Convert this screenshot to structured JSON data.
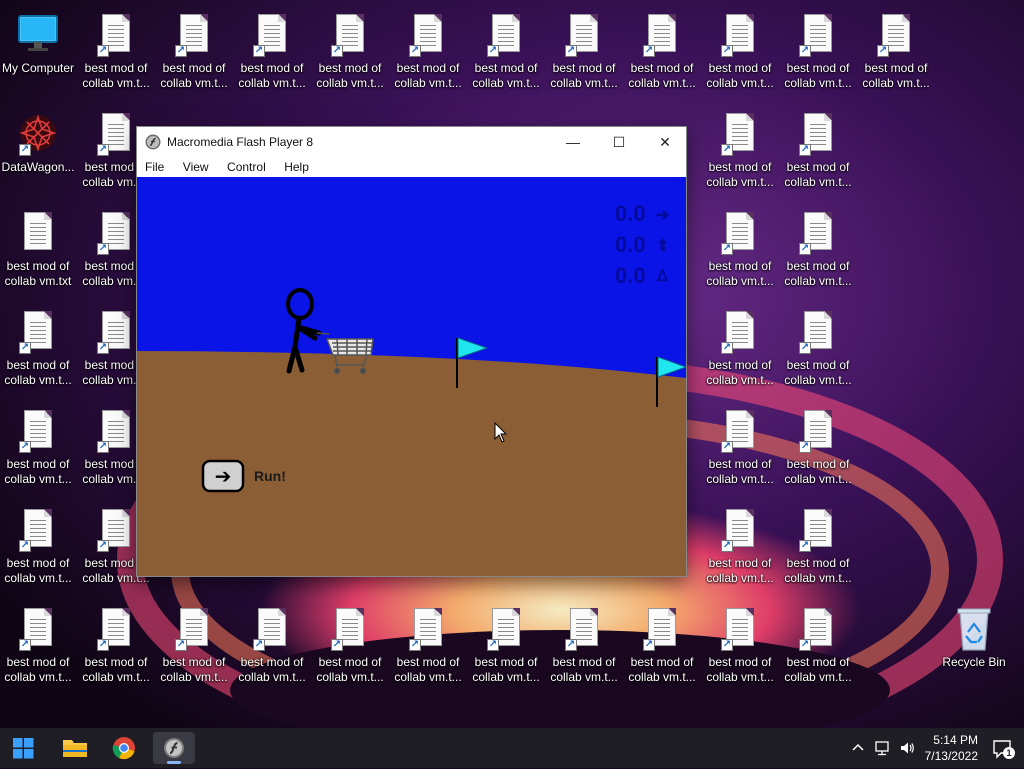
{
  "desktop": {
    "icons": [
      {
        "col": 0,
        "row": 0,
        "type": "computer",
        "label": "My Computer"
      },
      {
        "col": 1,
        "row": 0,
        "type": "doc",
        "label": "best mod of\ncollab vm.t...",
        "shortcut": true
      },
      {
        "col": 2,
        "row": 0,
        "type": "doc",
        "label": "best mod of\ncollab vm.t...",
        "shortcut": true
      },
      {
        "col": 3,
        "row": 0,
        "type": "doc",
        "label": "best mod of\ncollab vm.t...",
        "shortcut": true
      },
      {
        "col": 4,
        "row": 0,
        "type": "doc",
        "label": "best mod of\ncollab vm.t...",
        "shortcut": true
      },
      {
        "col": 5,
        "row": 0,
        "type": "doc",
        "label": "best mod of\ncollab vm.t...",
        "shortcut": true
      },
      {
        "col": 6,
        "row": 0,
        "type": "doc",
        "label": "best mod of\ncollab vm.t...",
        "shortcut": true
      },
      {
        "col": 7,
        "row": 0,
        "type": "doc",
        "label": "best mod of\ncollab vm.t...",
        "shortcut": true
      },
      {
        "col": 8,
        "row": 0,
        "type": "doc",
        "label": "best mod of\ncollab vm.t...",
        "shortcut": true
      },
      {
        "col": 9,
        "row": 0,
        "type": "doc",
        "label": "best mod of\ncollab vm.t...",
        "shortcut": true
      },
      {
        "col": 10,
        "row": 0,
        "type": "doc",
        "label": "best mod of\ncollab vm.t...",
        "shortcut": true
      },
      {
        "col": 11,
        "row": 0,
        "type": "doc",
        "label": "best mod of\ncollab vm.t...",
        "shortcut": true
      },
      {
        "col": 0,
        "row": 1,
        "type": "datawagon",
        "label": "DataWagon...",
        "shortcut": true
      },
      {
        "col": 1,
        "row": 1,
        "type": "doc",
        "label": "best mod of\ncollab vm.t...",
        "shortcut": true
      },
      {
        "col": 9,
        "row": 1,
        "type": "doc",
        "label": "best mod of\ncollab vm.t...",
        "shortcut": true
      },
      {
        "col": 10,
        "row": 1,
        "type": "doc",
        "label": "best mod of\ncollab vm.t...",
        "shortcut": true
      },
      {
        "col": 0,
        "row": 2,
        "type": "doc",
        "label": "best mod of\ncollab vm.txt",
        "shortcut": false
      },
      {
        "col": 1,
        "row": 2,
        "type": "doc",
        "label": "best mod of\ncollab vm.t...",
        "shortcut": true
      },
      {
        "col": 9,
        "row": 2,
        "type": "doc",
        "label": "best mod of\ncollab vm.t...",
        "shortcut": true
      },
      {
        "col": 10,
        "row": 2,
        "type": "doc",
        "label": "best mod of\ncollab vm.t...",
        "shortcut": true
      },
      {
        "col": 0,
        "row": 3,
        "type": "doc",
        "label": "best mod of\ncollab vm.t...",
        "shortcut": true
      },
      {
        "col": 1,
        "row": 3,
        "type": "doc",
        "label": "best mod of\ncollab vm.t...",
        "shortcut": true
      },
      {
        "col": 9,
        "row": 3,
        "type": "doc",
        "label": "best mod of\ncollab vm.t...",
        "shortcut": true
      },
      {
        "col": 10,
        "row": 3,
        "type": "doc",
        "label": "best mod of\ncollab vm.t...",
        "shortcut": true
      },
      {
        "col": 0,
        "row": 4,
        "type": "doc",
        "label": "best mod of\ncollab vm.t...",
        "shortcut": true
      },
      {
        "col": 1,
        "row": 4,
        "type": "doc",
        "label": "best mod of\ncollab vm.t...",
        "shortcut": true
      },
      {
        "col": 9,
        "row": 4,
        "type": "doc",
        "label": "best mod of\ncollab vm.t...",
        "shortcut": true
      },
      {
        "col": 10,
        "row": 4,
        "type": "doc",
        "label": "best mod of\ncollab vm.t...",
        "shortcut": true
      },
      {
        "col": 0,
        "row": 5,
        "type": "doc",
        "label": "best mod of\ncollab vm.t...",
        "shortcut": true
      },
      {
        "col": 1,
        "row": 5,
        "type": "doc",
        "label": "best mod of\ncollab vm.t...",
        "shortcut": true
      },
      {
        "col": 9,
        "row": 5,
        "type": "doc",
        "label": "best mod of\ncollab vm.t...",
        "shortcut": true
      },
      {
        "col": 10,
        "row": 5,
        "type": "doc",
        "label": "best mod of\ncollab vm.t...",
        "shortcut": true
      },
      {
        "col": 0,
        "row": 6,
        "type": "doc",
        "label": "best mod of\ncollab vm.t...",
        "shortcut": true
      },
      {
        "col": 1,
        "row": 6,
        "type": "doc",
        "label": "best mod of\ncollab vm.t...",
        "shortcut": true
      },
      {
        "col": 2,
        "row": 6,
        "type": "doc",
        "label": "best mod of\ncollab vm.t...",
        "shortcut": true
      },
      {
        "col": 3,
        "row": 6,
        "type": "doc",
        "label": "best mod of\ncollab vm.t...",
        "shortcut": true
      },
      {
        "col": 4,
        "row": 6,
        "type": "doc",
        "label": "best mod of\ncollab vm.t...",
        "shortcut": true
      },
      {
        "col": 5,
        "row": 6,
        "type": "doc",
        "label": "best mod of\ncollab vm.t...",
        "shortcut": true
      },
      {
        "col": 6,
        "row": 6,
        "type": "doc",
        "label": "best mod of\ncollab vm.t...",
        "shortcut": true
      },
      {
        "col": 7,
        "row": 6,
        "type": "doc",
        "label": "best mod of\ncollab vm.t...",
        "shortcut": true
      },
      {
        "col": 8,
        "row": 6,
        "type": "doc",
        "label": "best mod of\ncollab vm.t...",
        "shortcut": true
      },
      {
        "col": 9,
        "row": 6,
        "type": "doc",
        "label": "best mod of\ncollab vm.t...",
        "shortcut": true
      },
      {
        "col": 10,
        "row": 6,
        "type": "doc",
        "label": "best mod of\ncollab vm.t...",
        "shortcut": true
      },
      {
        "col": 12,
        "row": 6,
        "type": "recycle",
        "label": "Recycle Bin",
        "shortcut": false
      }
    ]
  },
  "window": {
    "title": "Macromedia Flash Player 8",
    "menu": [
      "File",
      "View",
      "Control",
      "Help"
    ],
    "buttons": {
      "minimize": "—",
      "maximize": "☐",
      "close": "✕"
    }
  },
  "game": {
    "stats": [
      {
        "value": "0.0",
        "symbol": "➔"
      },
      {
        "value": "0.0",
        "symbol": "⬆"
      },
      {
        "value": "0.0",
        "symbol": "ᐃ"
      }
    ],
    "run_label": "Run!",
    "run_arrow": "➔",
    "colors": {
      "sky": "#0a14e6",
      "ground": "#8c5e36",
      "flag": "#20e6ee"
    }
  },
  "taskbar": {
    "time": "5:14 PM",
    "date": "7/13/2022",
    "notification_count": "1"
  }
}
